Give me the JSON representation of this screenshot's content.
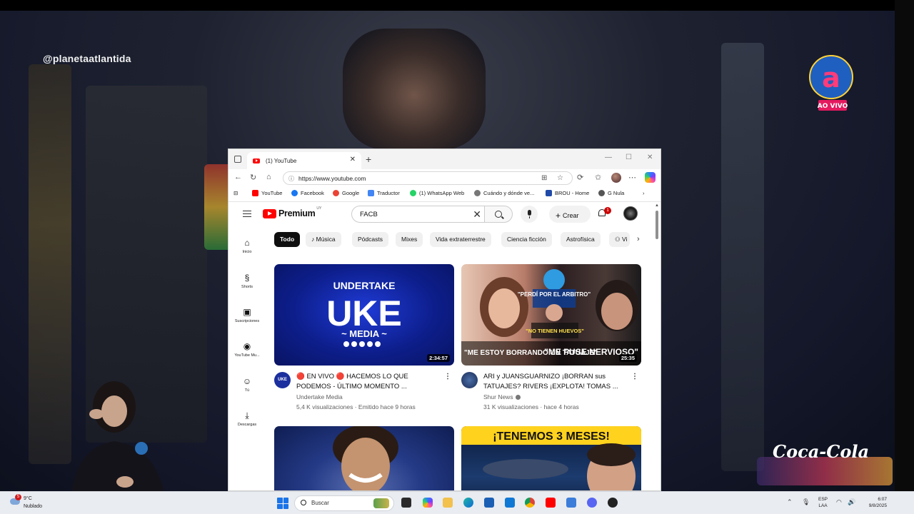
{
  "stream": {
    "watermark": "@planetaatlantida",
    "channel_logo_text": "AO VIVO",
    "sponsor": "Coca-Cola"
  },
  "browser": {
    "tab_title": "(1) YouTube",
    "url": "https://www.youtube.com",
    "bookmarks": [
      {
        "label": "YouTube",
        "color": "#ff0000"
      },
      {
        "label": "Facebook",
        "color": "#1877f2"
      },
      {
        "label": "Google",
        "color": "#ea4335"
      },
      {
        "label": "Traductor",
        "color": "#4285f4"
      },
      {
        "label": "(1) WhatsApp Web",
        "color": "#25d366"
      },
      {
        "label": "Cuándo y dónde ve...",
        "color": "#777777"
      },
      {
        "label": "BROU - Home",
        "color": "#1f4aa8"
      },
      {
        "label": "G Nula",
        "color": "#555555"
      }
    ]
  },
  "youtube": {
    "logo_word": "Premium",
    "region": "UY",
    "search_value": "FACB",
    "create_label": "Crear",
    "notifications": "1",
    "sidebar": [
      {
        "label": "Inicio",
        "icon": "home-icon",
        "glyph": "⌂"
      },
      {
        "label": "Shorts",
        "icon": "shorts-icon",
        "glyph": "§"
      },
      {
        "label": "Suscripciones",
        "icon": "subscriptions-icon",
        "glyph": "▣"
      },
      {
        "label": "YouTube Mu...",
        "icon": "music-icon",
        "glyph": "◉"
      },
      {
        "label": "Tú",
        "icon": "you-icon",
        "glyph": "☺"
      },
      {
        "label": "Descargas",
        "icon": "download-icon",
        "glyph": "⤓"
      }
    ],
    "chips": [
      "Todo",
      "Música",
      "Pódcasts",
      "Mixes",
      "Vida extraterrestre",
      "Ciencia ficción",
      "Astrofísica",
      "Vi"
    ],
    "videos": [
      {
        "thumb_title": "UNDERTAKE",
        "thumb_big": "UKE",
        "thumb_sub": "~ MEDIA ~",
        "duration": "2:34:57",
        "title": "🔴 EN VIVO 🔴 HACEMOS LO QUE PODEMOS - ÚLTIMO MOMENTO ...",
        "channel": "Undertake Media",
        "stats": "5,4 K visualizaciones · Emitido hace 9 horas",
        "avatar_text": "UKE"
      },
      {
        "thumb_line1": "\"PERDÍ POR EL ARBITRO\"",
        "thumb_line2": "\"NO TIENEN HUEVOS\"",
        "thumb_bottom_left": "\"ME ESTOY BORRANDO UN TATUAJE\"",
        "thumb_bottom_right": "\"ME PUSE NERVIOSO\"",
        "duration": "25:35",
        "title": "ARI y JUANSGUARNIZO ¡BORRAN sus TATUAJES? RIVERS ¡EXPLOTA! TOMAS ...",
        "channel": "Shur News",
        "stats": "31 K visualizaciones · hace 4 horas"
      },
      {
        "duration": ""
      },
      {
        "thumb_banner": "¡TENEMOS 3 MESES!"
      }
    ]
  },
  "taskbar": {
    "weather_temp": "9°C",
    "weather_cond": "Nublado",
    "weather_badge": "5",
    "search_placeholder": "Buscar",
    "lang_top": "ESP",
    "lang_bottom": "LAA",
    "time": "6:07",
    "date": "9/8/2025"
  }
}
